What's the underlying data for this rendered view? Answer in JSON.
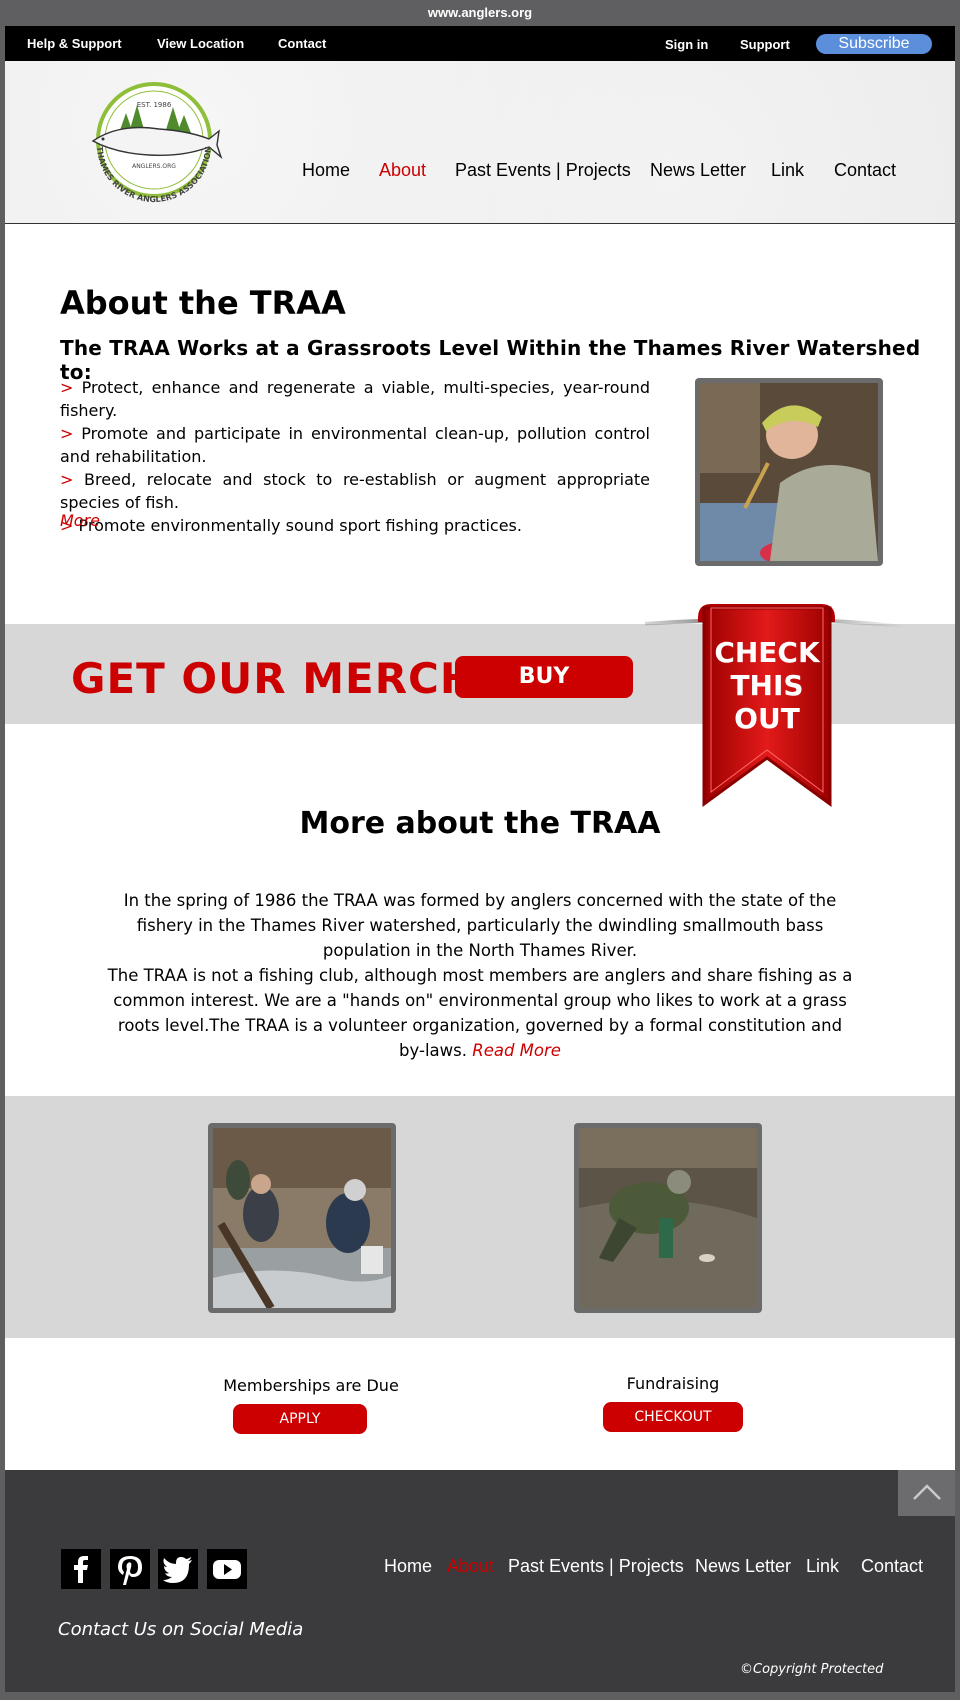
{
  "url": "www.anglers.org",
  "topbar": {
    "left_links": [
      "Help & Support",
      "View Location",
      "Contact"
    ],
    "sign_in": "Sign in",
    "support": "Support",
    "subscribe": "Subscribe"
  },
  "logo": {
    "est": "EST. 1986",
    "site": "ANGLERS.ORG",
    "ring_text": "THAMES RIVER ANGLERS ASSOCIATION"
  },
  "nav": [
    "Home",
    "About",
    "Past Events | Projects",
    "News Letter",
    "Link",
    "Contact"
  ],
  "nav_active": "About",
  "about": {
    "title": "About the TRAA",
    "subtitle": "The TRAA Works at a Grassroots Level Within the Thames River Watershed to:",
    "arrow": ">",
    "bullets": [
      "Protect, enhance and regenerate a viable, multi-species, year-round fishery.",
      "Promote and participate in environmental clean-up, pollution control and rehabilitation.",
      "Breed, relocate and stock to re-establish or augment appropriate species of fish.",
      "Promote environmentally sound sport fishing practices."
    ],
    "more": "More"
  },
  "merch": {
    "text": "GET OUR MERCH",
    "buy": "BUY",
    "ribbon_lines": [
      "CHECK",
      "THIS",
      "OUT"
    ]
  },
  "more_about": {
    "title": "More about the TRAA",
    "para1": "In the spring of 1986 the TRAA was formed by anglers concerned with the state of the fishery in the Thames River watershed, particularly the dwindling smallmouth bass population in the North Thames River.",
    "para2": "The TRAA is not a fishing club, although most members are anglers and share fishing as a common interest. We are a \"hands on\" environmental group who likes to work at a grass roots level.The TRAA is a volunteer organization, governed by a formal constitution and by-laws.",
    "read_more": "Read More"
  },
  "cta": {
    "membership_label": "Memberships are Due",
    "apply": "APPLY",
    "fundraising_label": "Fundraising",
    "checkout": "CHECKOUT"
  },
  "footer": {
    "social_icons": [
      "facebook-icon",
      "pinterest-icon",
      "twitter-icon",
      "youtube-icon"
    ],
    "social_caption": "Contact Us on Social Media",
    "nav": [
      "Home",
      "About",
      "Past Events | Projects",
      "News Letter",
      "Link",
      "Contact"
    ],
    "copyright": "©Copyright Protected"
  },
  "colors": {
    "accent": "#cc0000",
    "subscribe": "#5b8fdc",
    "band": "#d7d7d7",
    "footer": "#3b3b3d"
  }
}
